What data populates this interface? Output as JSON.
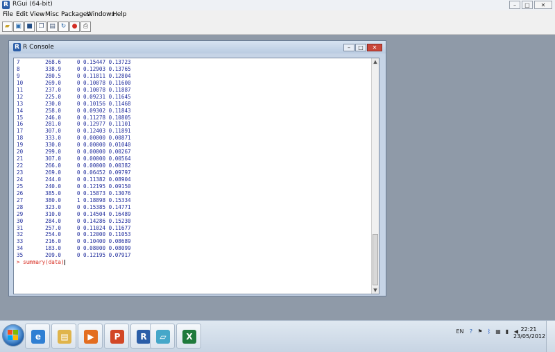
{
  "app": {
    "title": "RGui (64-bit)",
    "logo_letter": "R",
    "window_controls": {
      "minimize": "–",
      "maximize": "□",
      "close": "✕"
    }
  },
  "menu": [
    "File",
    "Edit",
    "View",
    "Misc",
    "Packages",
    "Windows",
    "Help"
  ],
  "toolbar": {
    "icons": [
      "open-script-icon",
      "load-workspace-icon",
      "save-workspace-icon",
      "copy-icon",
      "paste-icon",
      "copy-paste-icon",
      "stop-icon",
      "print-icon"
    ]
  },
  "console": {
    "title": "R Console",
    "logo_letter": "R",
    "window_controls": {
      "minimize": "–",
      "maximize": "□",
      "close": "✕"
    },
    "lines": [
      "7        268.6     0 0.15447 0.13723",
      "8        338.9     0 0.12903 0.13765",
      "9        280.5     0 0.11811 0.12804",
      "10       269.0     0 0.10078 0.11600",
      "11       237.0     0 0.10078 0.11887",
      "12       225.0     0 0.09231 0.11645",
      "13       230.0     0 0.10156 0.11468",
      "14       258.0     0 0.09302 0.11843",
      "15       246.0     0 0.11278 0.10805",
      "16       281.0     0 0.12977 0.11101",
      "17       307.0     0 0.12403 0.11891",
      "18       333.0     0 0.00000 0.00871",
      "19       330.0     0 0.00000 0.01040",
      "20       299.0     0 0.00000 0.00267",
      "21       307.0     0 0.00000 0.00564",
      "22       266.0     0 0.00000 0.00382",
      "23       269.0     0 0.06452 0.09797",
      "24       244.0     0 0.11382 0.08904",
      "25       240.0     0 0.12195 0.09150",
      "26       385.0     0 0.15873 0.13076",
      "27       380.0     1 0.18898 0.15334",
      "28       323.0     0 0.15385 0.14771",
      "29       310.0     0 0.14504 0.16489",
      "30       284.0     0 0.14286 0.15230",
      "31       257.0     0 0.11024 0.11677",
      "32       254.0     0 0.12000 0.11053",
      "33       216.0     0 0.10400 0.08689",
      "34       183.0     0 0.08000 0.08099",
      "35       209.0     0 0.12195 0.07917"
    ],
    "prompt": "> summary(data)",
    "scroll": {
      "up": "▲",
      "down": "▼"
    }
  },
  "taskbar": {
    "apps": [
      {
        "name": "internet-explorer",
        "glyph": "e",
        "color": "#2f7fd3"
      },
      {
        "name": "windows-explorer",
        "glyph": "▤",
        "color": "#e0b44a"
      },
      {
        "name": "media-player",
        "glyph": "▶",
        "color": "#e36d20"
      },
      {
        "name": "powerpoint",
        "glyph": "P",
        "color": "#d24726"
      },
      {
        "name": "rgui",
        "glyph": "R",
        "color": "#2b5ea8"
      },
      {
        "name": "notepad-app",
        "glyph": "▱",
        "color": "#45a7c9"
      },
      {
        "name": "excel",
        "glyph": "X",
        "color": "#1f7a3c"
      }
    ],
    "tray": {
      "language": "EN",
      "icons": [
        "help-icon",
        "flag-icon",
        "bluetooth-icon",
        "network-icon",
        "power-icon",
        "volume-icon"
      ]
    },
    "time": "22:21",
    "date": "23/05/2012"
  }
}
